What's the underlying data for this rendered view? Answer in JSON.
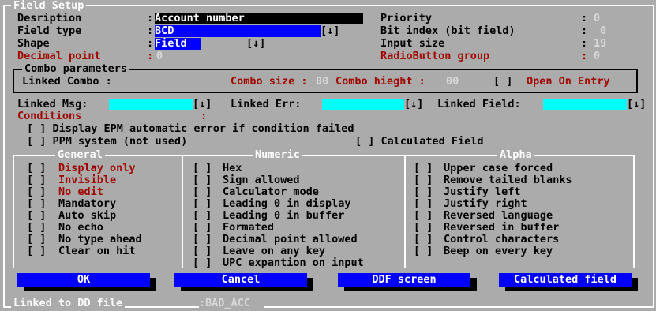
{
  "dialog": {
    "title": "Field Setup"
  },
  "fields": {
    "description": {
      "label": "Desription",
      "value": "Account number"
    },
    "field_type": {
      "label": "Field type",
      "value": "BCD",
      "arrow": "[↓]"
    },
    "shape": {
      "label": "Shape",
      "value": "Field",
      "arrow": "[↓]"
    },
    "decimal_point": {
      "label": "Decimal point",
      "value": "0"
    },
    "priority": {
      "label": "Priority",
      "value": "0"
    },
    "bit_index": {
      "label": "Bit index (bit field)",
      "value": "0"
    },
    "input_size": {
      "label": "Input size",
      "value": "19"
    },
    "radiobutton_group": {
      "label": "RadioButton group",
      "value": "0"
    }
  },
  "combo": {
    "title": "Combo parameters",
    "linked_label": "Linked Combo :",
    "size_label": "Combo size :",
    "size_value": "00",
    "height_label": "Combo hieght :",
    "height_value": "00",
    "open_checkbox": "[ ]",
    "open_label": "Open On Entry"
  },
  "links": {
    "msg_label": "Linked Msg:",
    "err_label": "Linked Err:",
    "field_label": "Linked Field:",
    "arrow": "[↓]"
  },
  "conditions": {
    "label": "Conditions",
    "colon": ":"
  },
  "options": {
    "display_epm": "[ ] Display EPM automatic error if condition failed",
    "ppm": "[ ] PPM system (not used)",
    "calculated": "[ ] Calculated Field"
  },
  "general": {
    "title": "General",
    "items": [
      "Display only",
      "Invisible",
      "No edit",
      "Mandatory",
      "Auto skip",
      "No echo",
      "No type ahead",
      "Clear on hit"
    ]
  },
  "numeric": {
    "title": "Numeric",
    "items": [
      "Hex",
      "Sign allowed",
      "Calculator mode",
      "Leading 0 in display",
      "Leading 0 in buffer",
      "Formated",
      "Decimal point allowed",
      "Leave on any key",
      "UPC expantion on input"
    ]
  },
  "alpha": {
    "title": "Alpha",
    "items": [
      "Upper case forced",
      "Remove tailed blanks",
      "Justify left",
      "Justify right",
      "Reversed language",
      "Reversed in buffer",
      "Control characters",
      "Beep on every key"
    ]
  },
  "checkbox": "[ ]",
  "buttons": {
    "ok": "OK",
    "cancel": "Cancel",
    "ddf": "DDF screen",
    "calc": "Calculated field"
  },
  "footer": {
    "label": "Linked to DD file",
    "colon": ":",
    "value": "BAD_ACC"
  }
}
